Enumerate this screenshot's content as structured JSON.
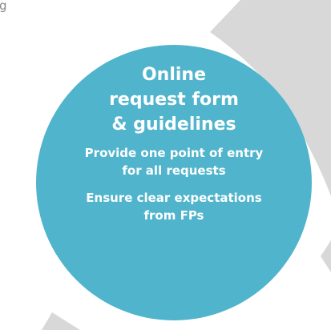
{
  "fragment_text": "g",
  "circle": {
    "title_lines": [
      "Online",
      "request form",
      "& guidelines"
    ],
    "items": [
      "Provide one point of entry\n     for all requests",
      "Ensure clear expectations\n     from FPs"
    ]
  },
  "colors": {
    "circle_fill": "#4fb4cc",
    "ring_gray": "#d8d8d8",
    "text": "#ffffff"
  }
}
